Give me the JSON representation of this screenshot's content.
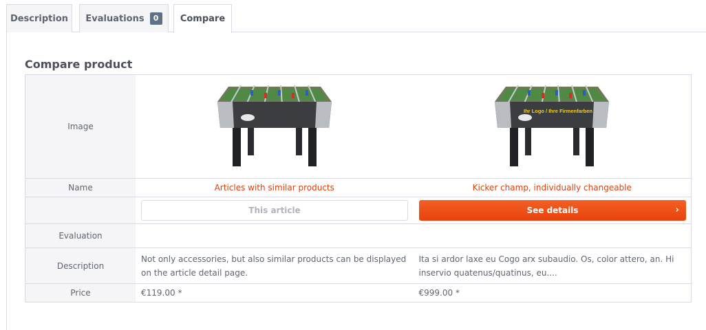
{
  "tabs": [
    {
      "label": "Description"
    },
    {
      "label": "Evaluations",
      "badge": "0"
    },
    {
      "label": "Compare"
    }
  ],
  "compare": {
    "heading": "Compare product",
    "labels": {
      "image": "Image",
      "name": "Name",
      "evaluation": "Evaluation",
      "description": "Description",
      "price": "Price"
    },
    "products": [
      {
        "name": "Articles with similar products",
        "button": "This article",
        "description": "Not only accessories, but also similar products can be displayed on the article detail page.",
        "price": "€119.00 *"
      },
      {
        "name": "Kicker champ, individually changeable",
        "button": "See details",
        "logo_text": "Ihr Logo / Ihre Firmenfarben",
        "description": "Ita si ardor laxe eu Cogo arx subaudio. Os, color attero, an. Hi inservio quatenus/quatinus, eu....",
        "price": "€999.00 *"
      }
    ]
  },
  "colors": {
    "accent": "#e8420c",
    "link": "#d9400b",
    "border": "#dadae5",
    "label_bg": "#f5f5f8"
  },
  "icons": {
    "chevron": "chevron-right-icon"
  }
}
